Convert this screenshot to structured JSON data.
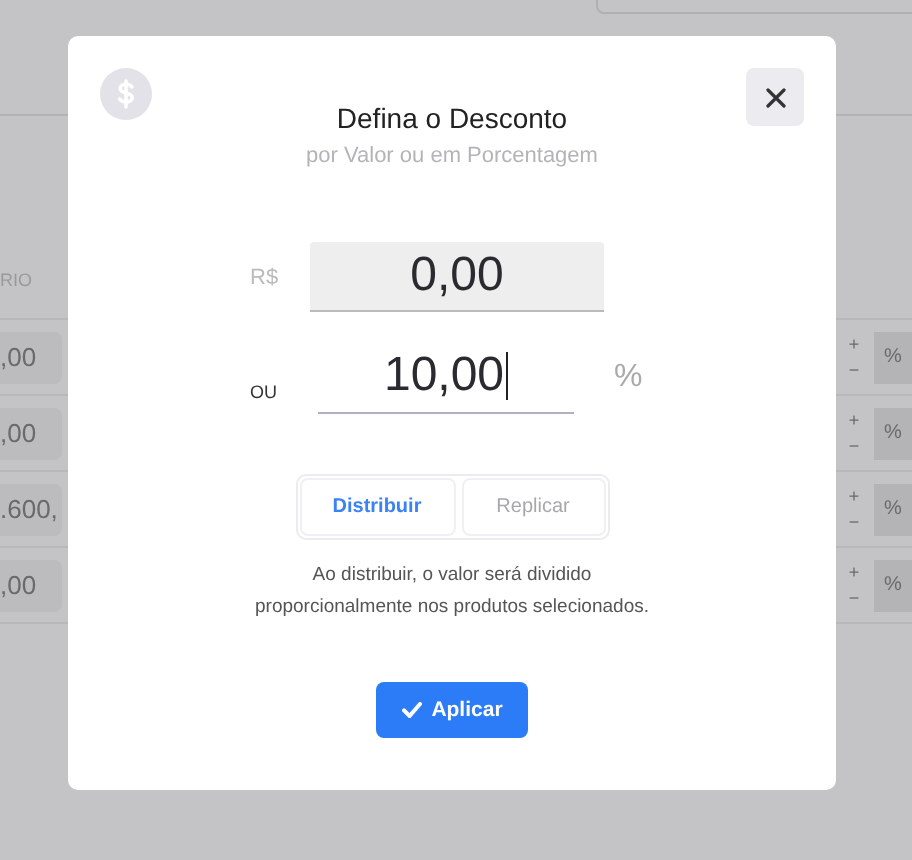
{
  "background": {
    "column_header": "RIO",
    "rows": [
      {
        "value": ",00",
        "plus": "+",
        "minus": "−",
        "unit": "%"
      },
      {
        "value": ",00",
        "plus": "+",
        "minus": "−",
        "unit": "%"
      },
      {
        "value": ".600,",
        "plus": "+",
        "minus": "−",
        "unit": "%"
      },
      {
        "value": ",00",
        "plus": "+",
        "minus": "−",
        "unit": "%"
      }
    ]
  },
  "dialog": {
    "title": "Defina o Desconto",
    "subtitle": "por Valor ou em Porcentagem",
    "currency_label": "R$",
    "amount_field": {
      "value": "0,00",
      "disabled": true
    },
    "or_label": "OU",
    "percent_field": {
      "value": "10,00",
      "disabled": false
    },
    "percent_unit": "%",
    "modes": [
      {
        "label": "Distribuir",
        "selected": true
      },
      {
        "label": "Replicar",
        "selected": false
      }
    ],
    "note": "Ao distribuir, o valor será dividido proporcionalmente nos produtos selecionados.",
    "apply_button": "Aplicar"
  }
}
